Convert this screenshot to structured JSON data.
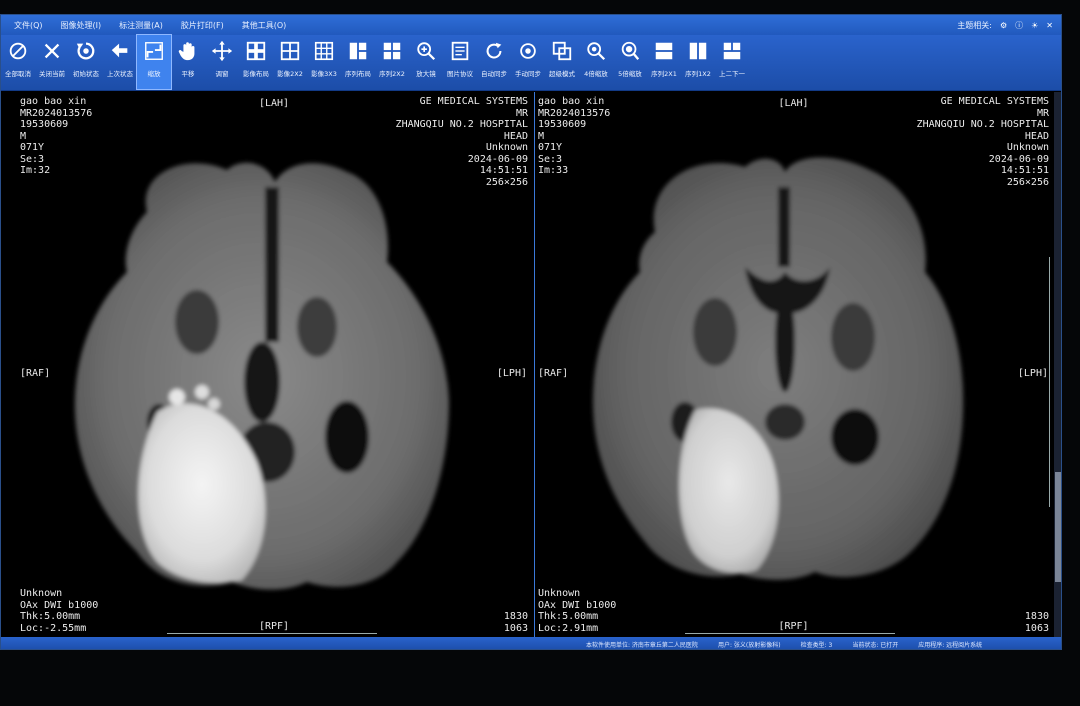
{
  "menu": {
    "items": [
      "文件(Q)",
      "图像处理(I)",
      "标注测量(A)",
      "胶片打印(F)",
      "其他工具(O)"
    ],
    "theme_label": "主题相关:",
    "icons": [
      "gear-icon",
      "info-icon",
      "brightness-icon",
      "close-icon"
    ]
  },
  "toolbar": {
    "tools": [
      {
        "label": "全部取消",
        "icon": "cancel-all-icon"
      },
      {
        "label": "关闭当前",
        "icon": "close-current-icon"
      },
      {
        "label": "初始状态",
        "icon": "reset-icon"
      },
      {
        "label": "上次状态",
        "icon": "undo-icon"
      },
      {
        "label": "缩放",
        "icon": "zoom-icon",
        "active": true
      },
      {
        "label": "平移",
        "icon": "pan-hand-icon"
      },
      {
        "label": "调窗",
        "icon": "window-level-icon"
      },
      {
        "label": "影像布局",
        "icon": "image-layout-icon"
      },
      {
        "label": "影像2X2",
        "icon": "grid-2x2-icon"
      },
      {
        "label": "影像3X3",
        "icon": "grid-3x3-icon"
      },
      {
        "label": "序列布局",
        "icon": "series-layout-icon"
      },
      {
        "label": "序列2X2",
        "icon": "series-2x2-icon"
      },
      {
        "label": "放大镜",
        "icon": "magnifier-icon"
      },
      {
        "label": "图片协议",
        "icon": "protocol-icon"
      },
      {
        "label": "自动同步",
        "icon": "auto-sync-icon"
      },
      {
        "label": "手动同步",
        "icon": "manual-sync-icon"
      },
      {
        "label": "超级模式",
        "icon": "super-mode-icon"
      },
      {
        "label": "4倍缩放",
        "icon": "zoom-4x-icon"
      },
      {
        "label": "5倍缩放",
        "icon": "zoom-5x-icon"
      },
      {
        "label": "序列2X1",
        "icon": "series-2x1-icon"
      },
      {
        "label": "序列1X2",
        "icon": "series-1x2-icon"
      },
      {
        "label": "上二下一",
        "icon": "layout-2-1-icon"
      }
    ]
  },
  "viewports": [
    {
      "patient_name": "gao bao xin",
      "patient_id": "MR2024013576",
      "birth_date": "19530609",
      "sex": "M",
      "age": "071Y",
      "series": "Se:3",
      "image": "Im:32",
      "manufacturer": "GE MEDICAL SYSTEMS",
      "modality": "MR",
      "institution": "ZHANGQIU NO.2 HOSPITAL",
      "body_part": "HEAD",
      "station": "Unknown",
      "date": "2024-06-09",
      "time": "14:51:51",
      "matrix": "256×256",
      "bl_unknown": "Unknown",
      "sequence": "OAx DWI b1000",
      "thickness": "Thk:5.00mm",
      "location": "Loc:-2.55mm",
      "window_width": "1830",
      "window_center": "1063",
      "orient_top": "[LAH]",
      "orient_bottom": "[RPF]",
      "orient_left": "[RAF]",
      "orient_right": "[LPH]"
    },
    {
      "patient_name": "gao bao xin",
      "patient_id": "MR2024013576",
      "birth_date": "19530609",
      "sex": "M",
      "age": "071Y",
      "series": "Se:3",
      "image": "Im:33",
      "manufacturer": "GE MEDICAL SYSTEMS",
      "modality": "MR",
      "institution": "ZHANGQIU NO.2 HOSPITAL",
      "body_part": "HEAD",
      "station": "Unknown",
      "date": "2024-06-09",
      "time": "14:51:51",
      "matrix": "256×256",
      "bl_unknown": "Unknown",
      "sequence": "OAx DWI b1000",
      "thickness": "Thk:5.00mm",
      "location": "Loc:2.91mm",
      "window_width": "1830",
      "window_center": "1063",
      "orient_top": "[LAH]",
      "orient_bottom": "[RPF]",
      "orient_left": "[RAF]",
      "orient_right": "[LPH]"
    }
  ],
  "status": {
    "items": [
      "本软件使用单位: 济南市章丘第二人民医院",
      "用户: 张义(放射影像科)",
      "检查类型: 3",
      "当前状态: 已打开",
      "应用程序: 远程阅片系统"
    ]
  }
}
